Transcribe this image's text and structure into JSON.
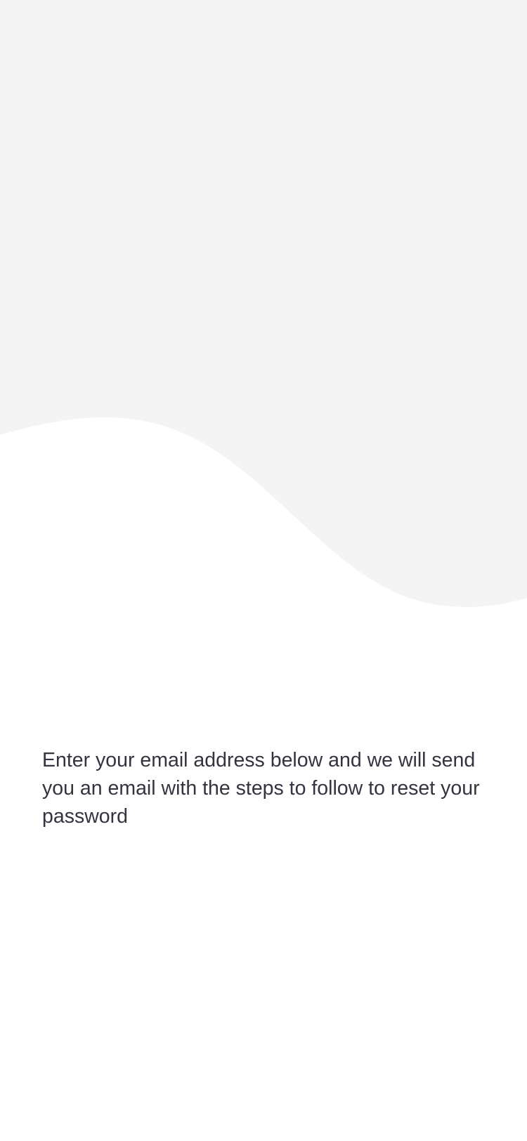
{
  "colors": {
    "background": "#ffffff",
    "wave": "#f4f4f4",
    "text": "#33343f"
  },
  "reset_password": {
    "instructions": "Enter your email address below and we will send you an email with the steps to follow to reset your password"
  }
}
